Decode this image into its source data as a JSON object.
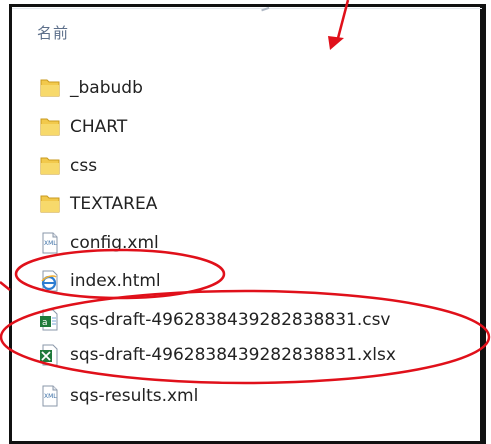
{
  "header": {
    "name_column": "名前"
  },
  "files": [
    {
      "name": "_babudb",
      "type": "folder",
      "icon": "folder-icon"
    },
    {
      "name": "CHART",
      "type": "folder",
      "icon": "folder-icon"
    },
    {
      "name": "css",
      "type": "folder",
      "icon": "folder-icon"
    },
    {
      "name": "TEXTAREA",
      "type": "folder",
      "icon": "folder-icon"
    },
    {
      "name": "config.xml",
      "type": "xml",
      "icon": "xml-file-icon"
    },
    {
      "name": "index.html",
      "type": "html",
      "icon": "ie-html-file-icon"
    },
    {
      "name": "sqs-draft-4962838439282838831.csv",
      "type": "csv",
      "icon": "excel-csv-file-icon"
    },
    {
      "name": "sqs-draft-4962838439282838831.xlsx",
      "type": "xlsx",
      "icon": "excel-xlsx-file-icon"
    },
    {
      "name": "sqs-results.xml",
      "type": "xml",
      "icon": "xml-file-icon"
    }
  ],
  "colors": {
    "annotation_red": "#e0101a",
    "folder_yellow": "#f2c94c",
    "header_text": "#5d6f8a"
  }
}
